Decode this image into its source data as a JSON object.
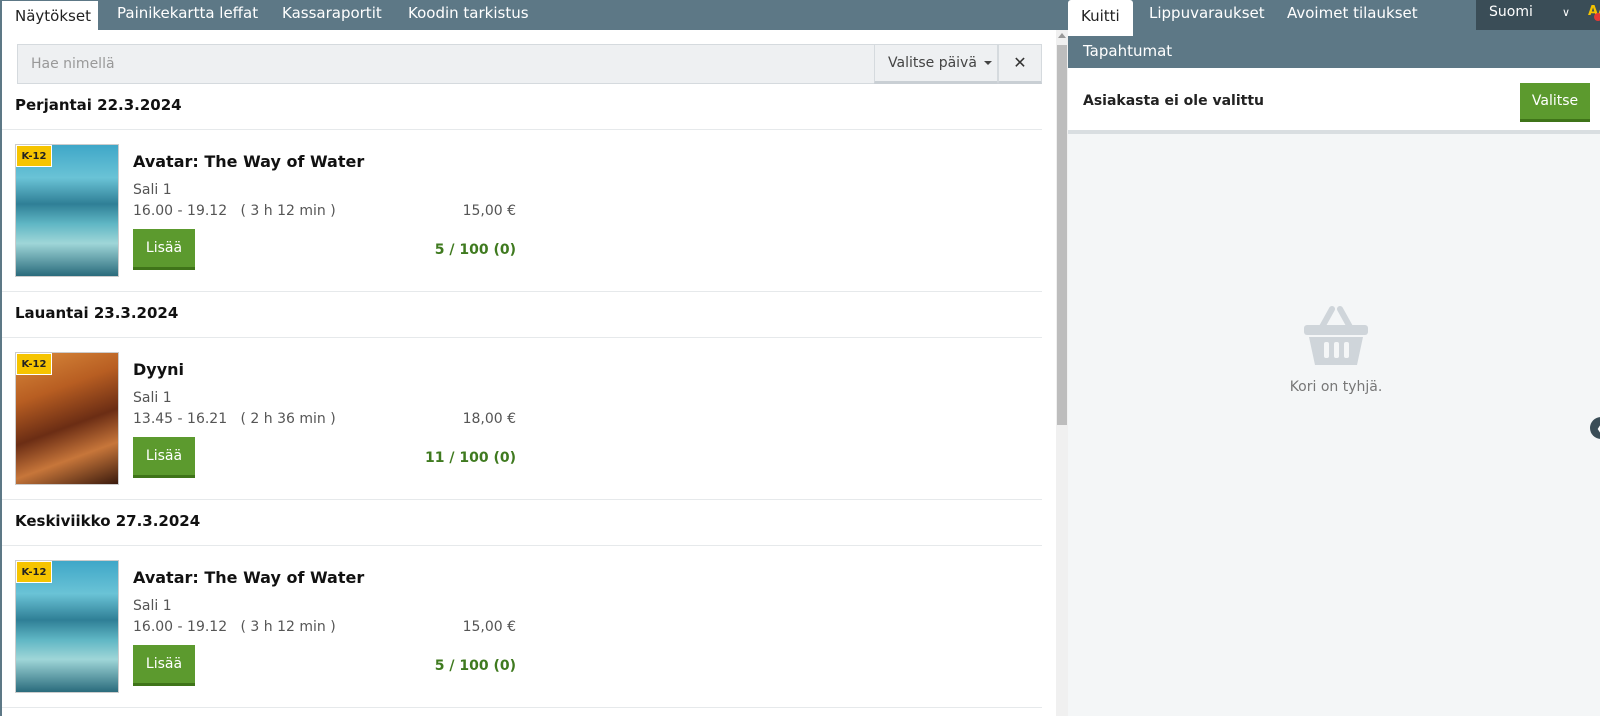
{
  "left_tabs": [
    {
      "label": "Näytökset",
      "active": true
    },
    {
      "label": "Painikekartta leffat",
      "active": false
    },
    {
      "label": "Kassaraportit",
      "active": false
    },
    {
      "label": "Koodin tarkistus",
      "active": false
    }
  ],
  "search": {
    "placeholder": "Hae nimellä",
    "date_label": "Valitse päivä",
    "clear_label": "✕"
  },
  "days": [
    {
      "header": "Perjantai 22.3.2024",
      "shows": [
        {
          "age": "K-12",
          "title": "Avatar: The Way of Water",
          "hall": "Sali 1",
          "time": "16.00 - 19.12",
          "duration": "( 3 h 12 min )",
          "price": "15,00 €",
          "add_label": "Lisää",
          "seats": "5 / 100 (0)",
          "poster": "avatar"
        }
      ]
    },
    {
      "header": "Lauantai 23.3.2024",
      "shows": [
        {
          "age": "K-12",
          "title": "Dyyni",
          "hall": "Sali 1",
          "time": "13.45 - 16.21",
          "duration": "( 2 h 36 min )",
          "price": "18,00 €",
          "add_label": "Lisää",
          "seats": "11 / 100 (0)",
          "poster": "dune"
        }
      ]
    },
    {
      "header": "Keskiviikko 27.3.2024",
      "shows": [
        {
          "age": "K-12",
          "title": "Avatar: The Way of Water",
          "hall": "Sali 1",
          "time": "16.00 - 19.12",
          "duration": "( 3 h 12 min )",
          "price": "15,00 €",
          "add_label": "Lisää",
          "seats": "5 / 100 (0)",
          "poster": "avatar"
        }
      ]
    }
  ],
  "right_tabs": [
    {
      "label": "Kuitti",
      "active": true
    },
    {
      "label": "Lippuvaraukset",
      "active": false
    },
    {
      "label": "Avoimet tilaukset",
      "active": false
    },
    {
      "label": "Tapahtumat",
      "active": false
    }
  ],
  "language": {
    "label": "Suomi",
    "icon": "chevron-down-icon"
  },
  "accessibility_icon": "text-size-icon",
  "customer": {
    "label": "Asiakasta ei ole valittu",
    "select_label": "Valitse"
  },
  "cart": {
    "empty_text": "Kori on tyhjä.",
    "icon": "basket-icon"
  },
  "colors": {
    "header_bg": "#5d7886",
    "accent_green": "#5c9a2e",
    "badge_yellow": "#f6c400",
    "dark_bg": "#3a4d57"
  }
}
